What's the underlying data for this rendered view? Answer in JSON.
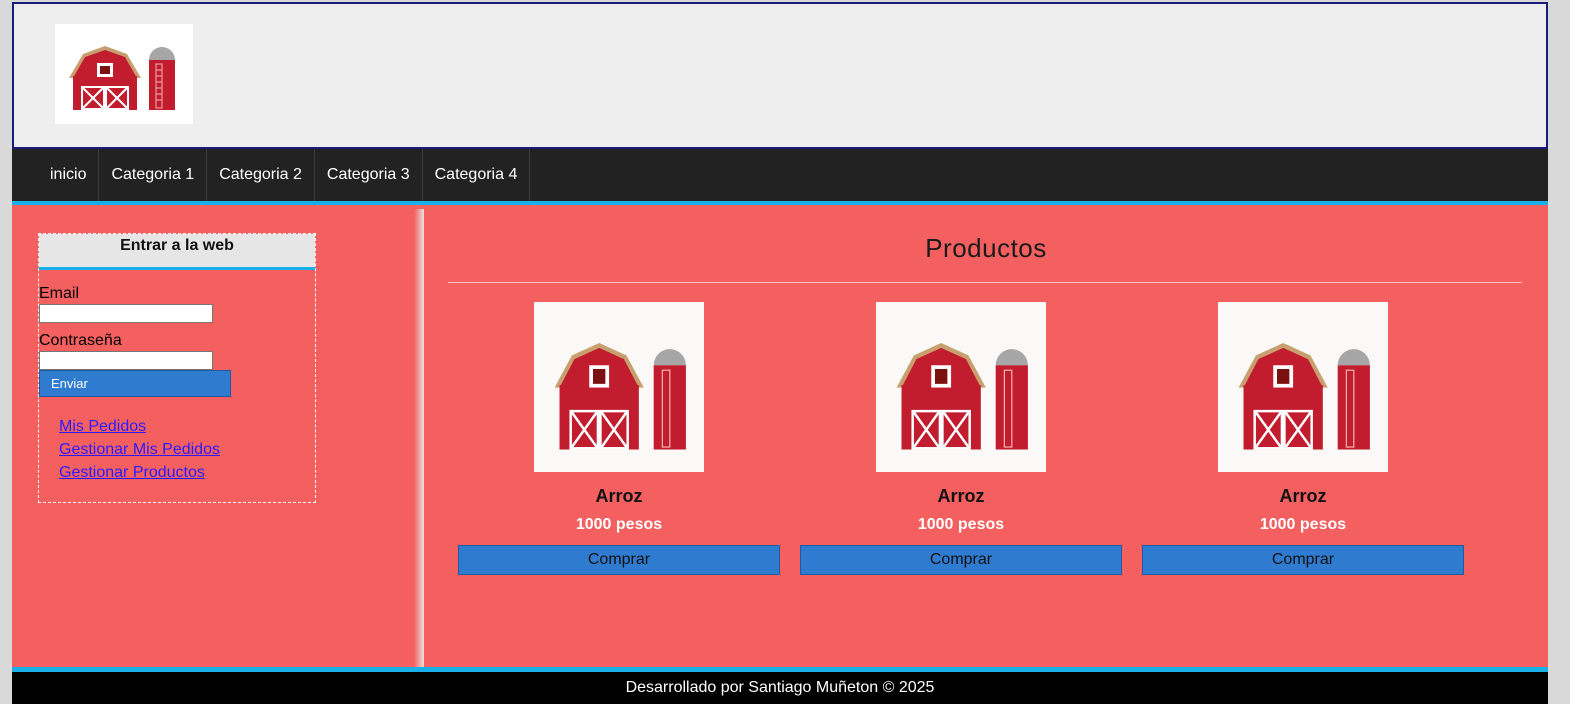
{
  "nav": {
    "items": [
      "inicio",
      "Categoria 1",
      "Categoria 2",
      "Categoria 3",
      "Categoria 4"
    ]
  },
  "login": {
    "title": "Entrar a la web",
    "email_label": "Email",
    "email_value": "",
    "password_label": "Contraseña",
    "password_value": "",
    "submit_label": "Enviar"
  },
  "sidebar_links": [
    "Mis Pedidos",
    "Gestionar Mis Pedidos",
    "Gestionar Productos"
  ],
  "main": {
    "title": "Productos",
    "products": [
      {
        "name": "Arroz",
        "price": "1000 pesos",
        "button": "Comprar"
      },
      {
        "name": "Arroz",
        "price": "1000 pesos",
        "button": "Comprar"
      },
      {
        "name": "Arroz",
        "price": "1000 pesos",
        "button": "Comprar"
      }
    ]
  },
  "footer": {
    "text": "Desarrollado por Santiago Muñeton © 2025"
  },
  "colors": {
    "page_bg": "#f46060",
    "nav_bg": "#222222",
    "accent": "#17b0e8",
    "button": "#2f7bd0",
    "footer_bg": "#000000"
  },
  "icons": {
    "logo": "barn-icon",
    "product_image": "barn-icon"
  }
}
